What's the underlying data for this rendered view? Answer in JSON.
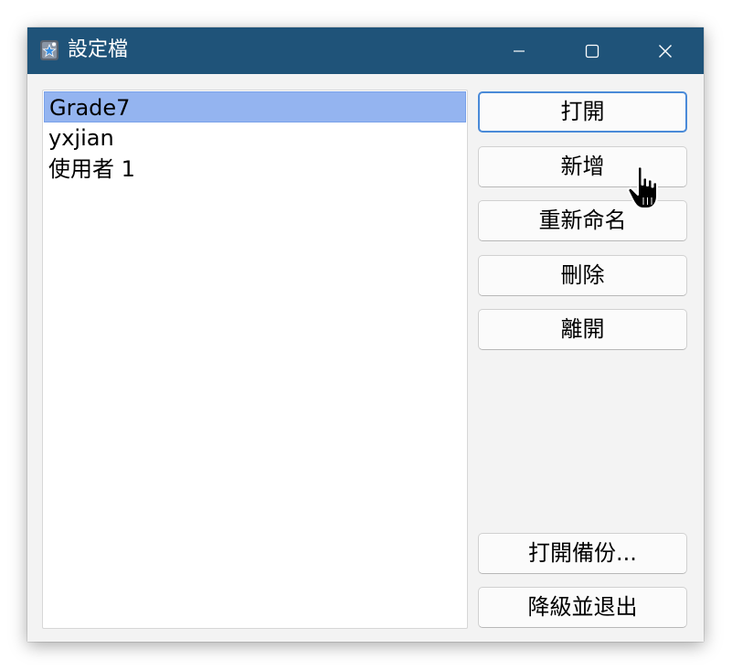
{
  "window": {
    "title": "設定檔",
    "controls": {
      "minimize_icon": "minimize-icon",
      "maximize_icon": "maximize-icon",
      "close_icon": "close-icon"
    },
    "titlebar_color": "#1f5379"
  },
  "profiles": {
    "items": [
      {
        "label": "Grade7",
        "selected": true
      },
      {
        "label": "yxjian",
        "selected": false
      },
      {
        "label": "使用者 1",
        "selected": false
      }
    ],
    "selection_color": "#94b4f0"
  },
  "actions": {
    "open": "打開",
    "new": "新增",
    "rename": "重新命名",
    "delete": "刪除",
    "exit": "離開",
    "open_backup": "打開備份...",
    "downgrade_exit": "降級並退出"
  },
  "cursor": {
    "type": "hand-pointer-icon"
  }
}
